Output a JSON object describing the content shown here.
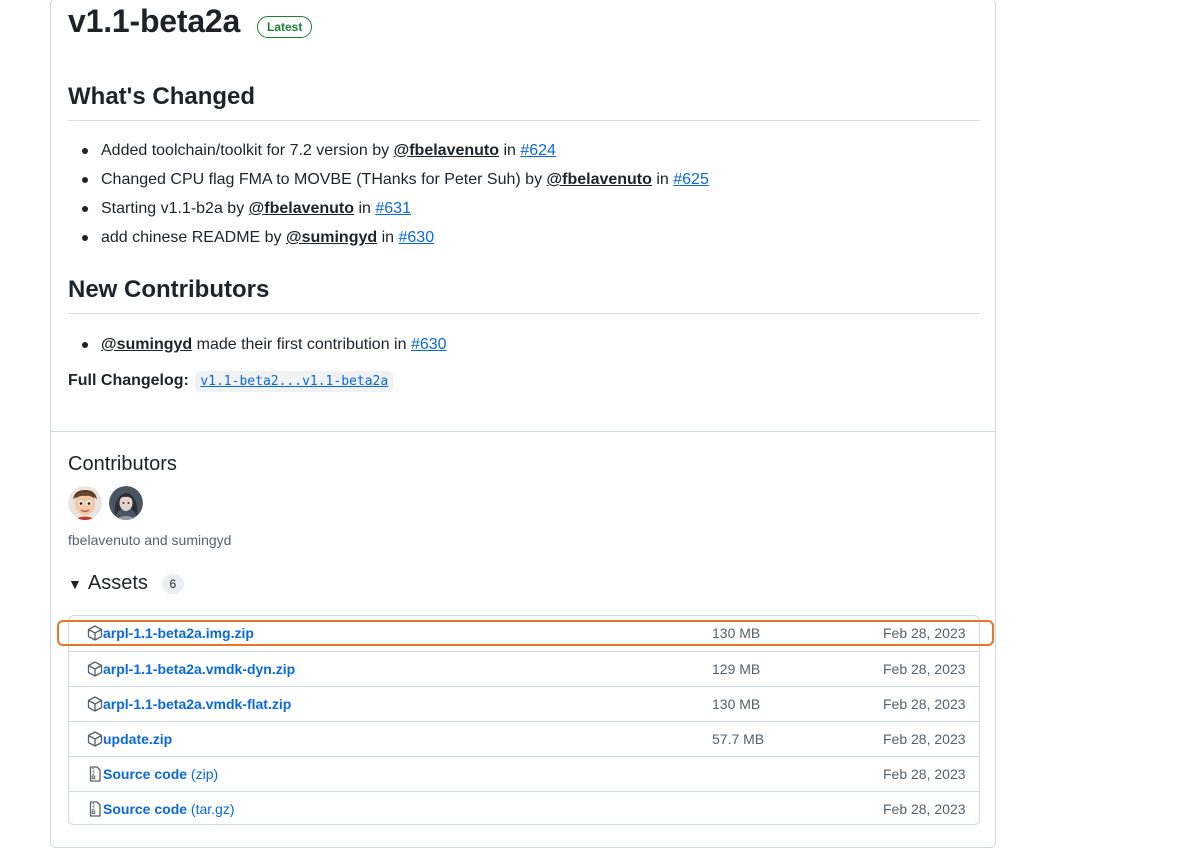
{
  "release": {
    "title": "v1.1-beta2a",
    "badge": "Latest"
  },
  "whats_changed": {
    "heading": "What's Changed",
    "items": [
      {
        "text": "Added toolchain/toolkit for 7.2 version by ",
        "author": "@fbelavenuto",
        "in": " in ",
        "pr": "#624"
      },
      {
        "text": "Changed CPU flag FMA to MOVBE (THanks for Peter Suh) by ",
        "author": "@fbelavenuto",
        "in": " in ",
        "pr": "#625"
      },
      {
        "text": "Starting v1.1-b2a by ",
        "author": "@fbelavenuto",
        "in": " in ",
        "pr": "#631"
      },
      {
        "text": "add chinese README by ",
        "author": "@sumingyd",
        "in": " in ",
        "pr": "#630"
      }
    ]
  },
  "new_contributors": {
    "heading": "New Contributors",
    "items": [
      {
        "author": "@sumingyd",
        "text": " made their first contribution in ",
        "pr": "#630"
      }
    ]
  },
  "full_changelog": {
    "label": "Full Changelog",
    "value": "v1.1-beta2...v1.1-beta2a"
  },
  "contributors": {
    "heading": "Contributors",
    "names": "fbelavenuto and sumingyd"
  },
  "assets": {
    "heading": "Assets",
    "count": "6",
    "rows": [
      {
        "icon": "package-icon",
        "name": "arpl-1.1-beta2a.img.zip",
        "ext": "",
        "size": "130 MB",
        "date": "Feb 28, 2023"
      },
      {
        "icon": "package-icon",
        "name": "arpl-1.1-beta2a.vmdk-dyn.zip",
        "ext": "",
        "size": "129 MB",
        "date": "Feb 28, 2023"
      },
      {
        "icon": "package-icon",
        "name": "arpl-1.1-beta2a.vmdk-flat.zip",
        "ext": "",
        "size": "130 MB",
        "date": "Feb 28, 2023"
      },
      {
        "icon": "package-icon",
        "name": "update.zip",
        "ext": "",
        "size": "57.7 MB",
        "date": "Feb 28, 2023"
      },
      {
        "icon": "file-zip-icon",
        "name": "Source code",
        "ext": " (zip)",
        "size": "",
        "date": "Feb 28, 2023"
      },
      {
        "icon": "file-zip-icon",
        "name": "Source code",
        "ext": " (tar.gz)",
        "size": "",
        "date": "Feb 28, 2023"
      }
    ]
  },
  "colors": {
    "link": "#0969da",
    "latest_green": "#1a7f37",
    "highlight": "#e8752a"
  }
}
